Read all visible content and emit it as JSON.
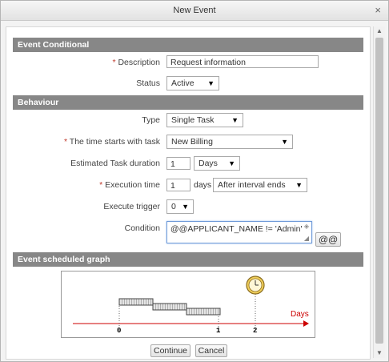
{
  "window": {
    "title": "New Event",
    "close_glyph": "×"
  },
  "sections": {
    "conditional": "Event Conditional",
    "behaviour": "Behaviour",
    "graph": "Event scheduled graph"
  },
  "fields": {
    "description": {
      "label": "Description",
      "value": "Request information"
    },
    "status": {
      "label": "Status",
      "value": "Active"
    },
    "type": {
      "label": "Type",
      "value": "Single Task"
    },
    "starts_with": {
      "label": "The time starts with task",
      "value": "New Billing"
    },
    "est_duration": {
      "label": "Estimated Task duration",
      "value": "1",
      "unit": "Days"
    },
    "exec_time": {
      "label": "Execution time",
      "value": "1",
      "unit_text": "days",
      "mode": "After interval ends"
    },
    "exec_trigger": {
      "label": "Execute trigger",
      "value": "0"
    },
    "condition": {
      "label": "Condition",
      "value": "@@APPLICANT_NAME != 'Admin'",
      "vars_button": "@@"
    }
  },
  "required_mark": "*",
  "graph": {
    "axis_label": "Days",
    "ticks": [
      "0",
      "1",
      "2"
    ]
  },
  "buttons": {
    "continue": "Continue",
    "cancel": "Cancel"
  },
  "colors": {
    "section_bg": "#878787",
    "required": "#c0392b",
    "axis": "#cc0000"
  }
}
